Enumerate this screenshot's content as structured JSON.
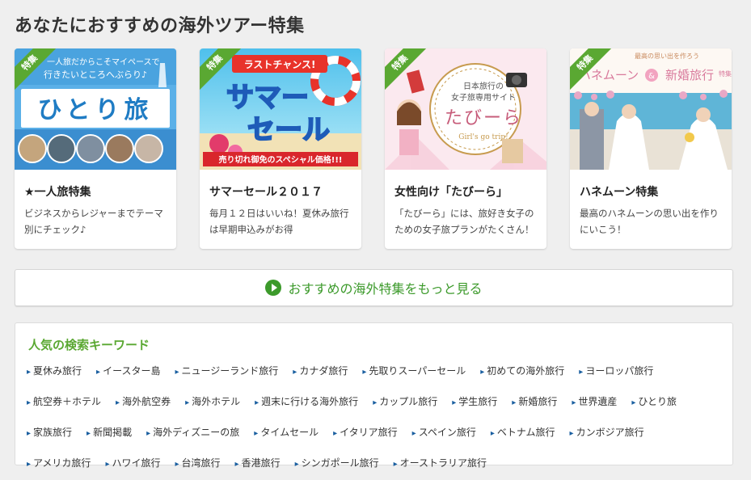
{
  "section_title": "あなたにおすすめの海外ツアー特集",
  "ribbon_label": "特集",
  "cards": [
    {
      "title": "★一人旅特集",
      "desc": "ビジネスからレジャーまでテーマ別にチェック♪",
      "banner_text1": "一人旅だからこそマイペースで",
      "banner_text2": "行きたいところへぶらり♪",
      "banner_main": "ひとり旅"
    },
    {
      "title": "サマーセール２０１７",
      "desc": "毎月１２日はいいね！夏休み旅行は早期申込みがお得",
      "banner_top": "ラストチャンス!",
      "banner_main1": "サマー",
      "banner_main2": "セール",
      "banner_bottom": "売り切れ御免のスペシャル価格!!!"
    },
    {
      "title": "女性向け「たびーら」",
      "desc": "「たびーら」には、旅好き女子のための女子旅プランがたくさん！",
      "banner_sub1": "日本旅行の",
      "banner_sub2": "女子旅専用サイト",
      "banner_main": "たびーら",
      "banner_en": "Girl's go trip!"
    },
    {
      "title": "ハネムーン特集",
      "desc": "最高のハネムーンの思い出を作りにいこう！",
      "banner_top": "最高の思い出を作ろう",
      "banner_main1": "ハネムーン",
      "banner_amp": "&",
      "banner_main2": "新婚旅行",
      "banner_small": "特集"
    }
  ],
  "more_button_label": "おすすめの海外特集をもっと見る",
  "keywords_title": "人気の検索キーワード",
  "keywords": [
    "夏休み旅行",
    "イースター島",
    "ニュージーランド旅行",
    "カナダ旅行",
    "先取りスーパーセール",
    "初めての海外旅行",
    "ヨーロッパ旅行",
    "航空券＋ホテル",
    "海外航空券",
    "海外ホテル",
    "週末に行ける海外旅行",
    "カップル旅行",
    "学生旅行",
    "新婚旅行",
    "世界遺産",
    "ひとり旅",
    "家族旅行",
    "新聞掲載",
    "海外ディズニーの旅",
    "タイムセール",
    "イタリア旅行",
    "スペイン旅行",
    "ベトナム旅行",
    "カンボジア旅行",
    "アメリカ旅行",
    "ハワイ旅行",
    "台湾旅行",
    "香港旅行",
    "シンガポール旅行",
    "オーストラリア旅行"
  ]
}
